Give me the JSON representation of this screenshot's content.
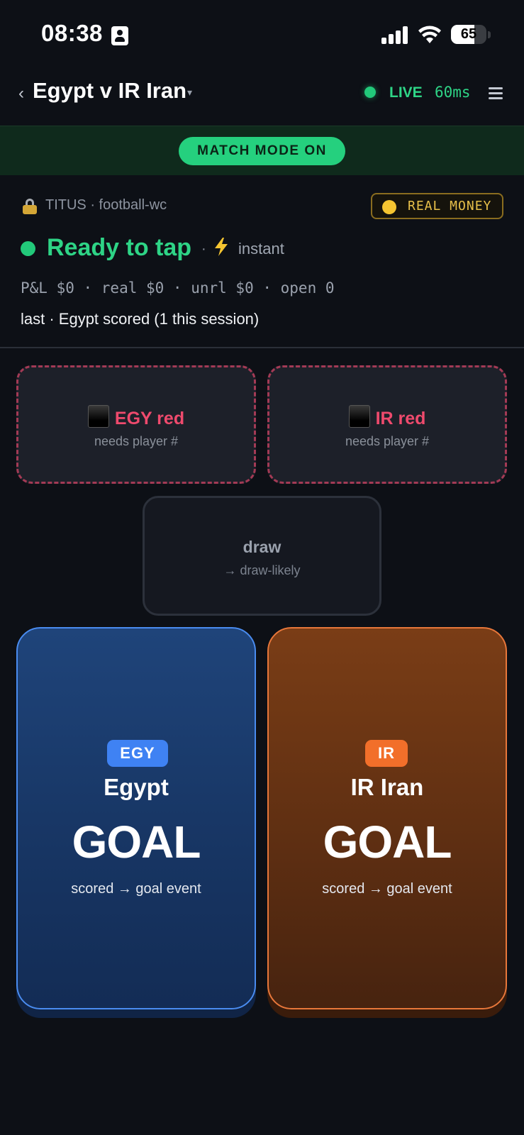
{
  "status_bar": {
    "time": "08:38",
    "battery": "65",
    "battery_level": 0.65
  },
  "header": {
    "back_icon": "chevron-left-icon",
    "title": "Egypt v IR Iran",
    "caret": "▾",
    "live_label": "LIVE",
    "latency": "60ms",
    "menu_icon": "hamburger-icon",
    "accent_color": "#2ed486"
  },
  "mode_bar": {
    "label": "MATCH MODE ON"
  },
  "account": {
    "icon": "lock-icon",
    "label": "TITUS · football-wc",
    "money_badge": "REAL MONEY"
  },
  "status": {
    "ready_text": "Ready to tap",
    "separator": "·",
    "bolt_icon": "lightning-icon",
    "instant_label": "instant",
    "pnl_line": "P&L $0 · real $0 · unrl $0 · open 0",
    "last_line": "last · Egypt scored (1 this session)"
  },
  "red_cards": [
    {
      "label": "EGY red",
      "sub": "needs player #"
    },
    {
      "label": "IR red",
      "sub": "needs player #"
    }
  ],
  "draw": {
    "label": "draw",
    "sub": "→ draw-likely"
  },
  "goals": [
    {
      "badge": "EGY",
      "team": "Egypt",
      "action": "GOAL",
      "sub": "scored → goal event",
      "color": "#3f82f3"
    },
    {
      "badge": "IR",
      "team": "IR Iran",
      "action": "GOAL",
      "sub": "scored → goal event",
      "color": "#f26f2a"
    }
  ]
}
